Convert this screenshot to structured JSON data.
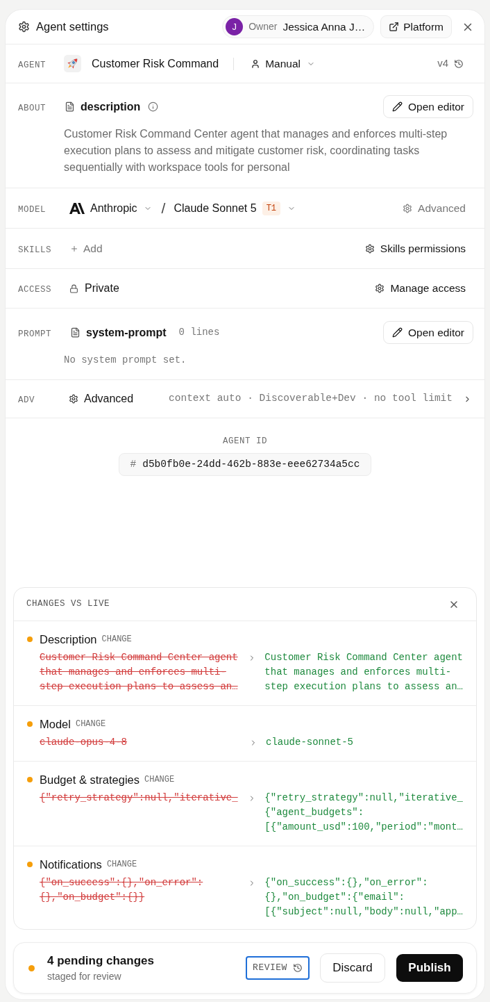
{
  "header": {
    "title": "Agent settings",
    "owner": {
      "initial": "J",
      "label": "Owner",
      "name": "Jessica Anna J…"
    },
    "platform_button": "Platform"
  },
  "agent": {
    "label": "AGENT",
    "name": "Customer Risk Command",
    "mode": "Manual",
    "version": "v4"
  },
  "about": {
    "label": "ABOUT",
    "file": "description",
    "button": "Open editor",
    "text": "Customer Risk Command Center agent that manages and enforces multi-step execution plans to assess and mitigate customer risk, coordinating tasks sequentially with workspace tools for personal"
  },
  "model": {
    "label": "MODEL",
    "provider": "Anthropic",
    "separator": "/",
    "model": "Claude Sonnet 5",
    "tier": "T1",
    "advanced": "Advanced"
  },
  "skills": {
    "label": "SKILLS",
    "add": "Add",
    "permissions": "Skills permissions"
  },
  "access": {
    "label": "ACCESS",
    "value": "Private",
    "manage": "Manage access"
  },
  "prompt": {
    "label": "PROMPT",
    "file": "system-prompt",
    "lines": "0 lines",
    "button": "Open editor",
    "empty_text": "No system prompt set."
  },
  "advanced": {
    "label": "ADV",
    "title": "Advanced",
    "summary": "context auto · Discoverable+Dev · no tool limit"
  },
  "agent_id": {
    "label": "AGENT ID",
    "prefix": "#",
    "value": "d5b0fb0e-24dd-462b-883e-eee62734a5cc"
  },
  "changes": {
    "title": "CHANGES VS LIVE",
    "items": [
      {
        "field": "Description",
        "tag": "CHANGE",
        "old": "Customer Risk Command Center agent\nthat manages and enforces multi-\nstep execution plans to assess an…",
        "new": "Customer Risk Command Center agent\nthat manages and enforces multi-\nstep execution plans to assess an…"
      },
      {
        "field": "Model",
        "tag": "CHANGE",
        "old": "claude-opus-4-8",
        "new": "claude-sonnet-5"
      },
      {
        "field": "Budget & strategies",
        "tag": "CHANGE",
        "old": "{\"retry_strategy\":null,\"iterative_",
        "new": "{\"retry_strategy\":null,\"iterative_\n{\"agent_budgets\":\n[{\"amount_usd\":100,\"period\":\"mont…"
      },
      {
        "field": "Notifications",
        "tag": "CHANGE",
        "old": "{\"on_success\":{},\"on_error\":\n{},\"on_budget\":{}}",
        "new": "{\"on_success\":{},\"on_error\":\n{},\"on_budget\":{\"email\":\n[{\"subject\":null,\"body\":null,\"app…"
      }
    ]
  },
  "footer": {
    "title": "4 pending changes",
    "subtitle": "staged for review",
    "review": {
      "label": "REVIEW",
      "focused": true
    },
    "discard": "Discard",
    "publish": "Publish"
  }
}
